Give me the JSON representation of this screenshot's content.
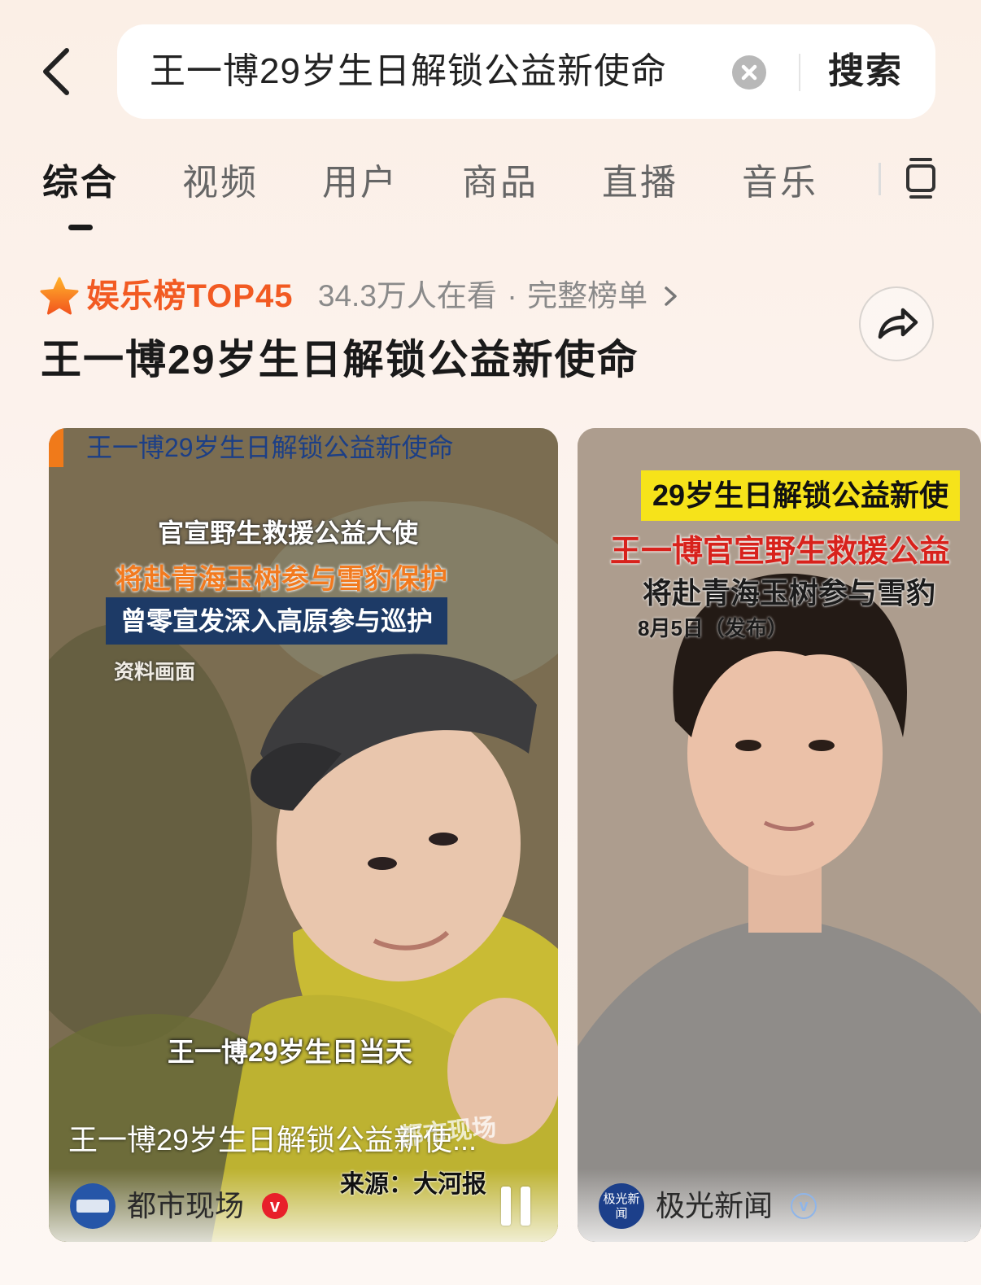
{
  "search": {
    "query": "王一博29岁生日解锁公益新使命",
    "submit_label": "搜索"
  },
  "tabs": [
    {
      "label": "综合",
      "active": true
    },
    {
      "label": "视频"
    },
    {
      "label": "用户"
    },
    {
      "label": "商品"
    },
    {
      "label": "直播"
    },
    {
      "label": "音乐"
    }
  ],
  "rank": {
    "label": "娱乐榜TOP45",
    "viewers": "34.3万人在看",
    "separator": "·",
    "full_list": "完整榜单"
  },
  "topic_title": "王一博29岁生日解锁公益新使命",
  "cards": [
    {
      "overlay_title": "王一博29岁生日解锁公益新使命",
      "overlay_line2": "官宣野生救援公益大使",
      "overlay_line3": "将赴青海玉树参与雪豹保护",
      "overlay_line4": "曾零宣发深入高原参与巡护",
      "archive_label": "资料画面",
      "subtitle": "王一博29岁生日当天",
      "watermark": "都市现场",
      "caption": "王一博29岁生日解锁公益新使...",
      "source": "来源：大河报",
      "author": "都市现场",
      "verify_mark": "v"
    },
    {
      "overlay_yellow": "29岁生日解锁公益新使",
      "overlay_red": "王一博官宣野生救援公益",
      "overlay_line3": "将赴青海玉树参与雪豹",
      "overlay_date": "8月5日（发布）",
      "author": "极光新闻",
      "avatar_text": "极光新闻",
      "verify_mark": "v"
    }
  ],
  "colors": {
    "accent_orange": "#f25a22",
    "verify_red": "#e8202a",
    "verify_blue": "#8fb5e9"
  }
}
